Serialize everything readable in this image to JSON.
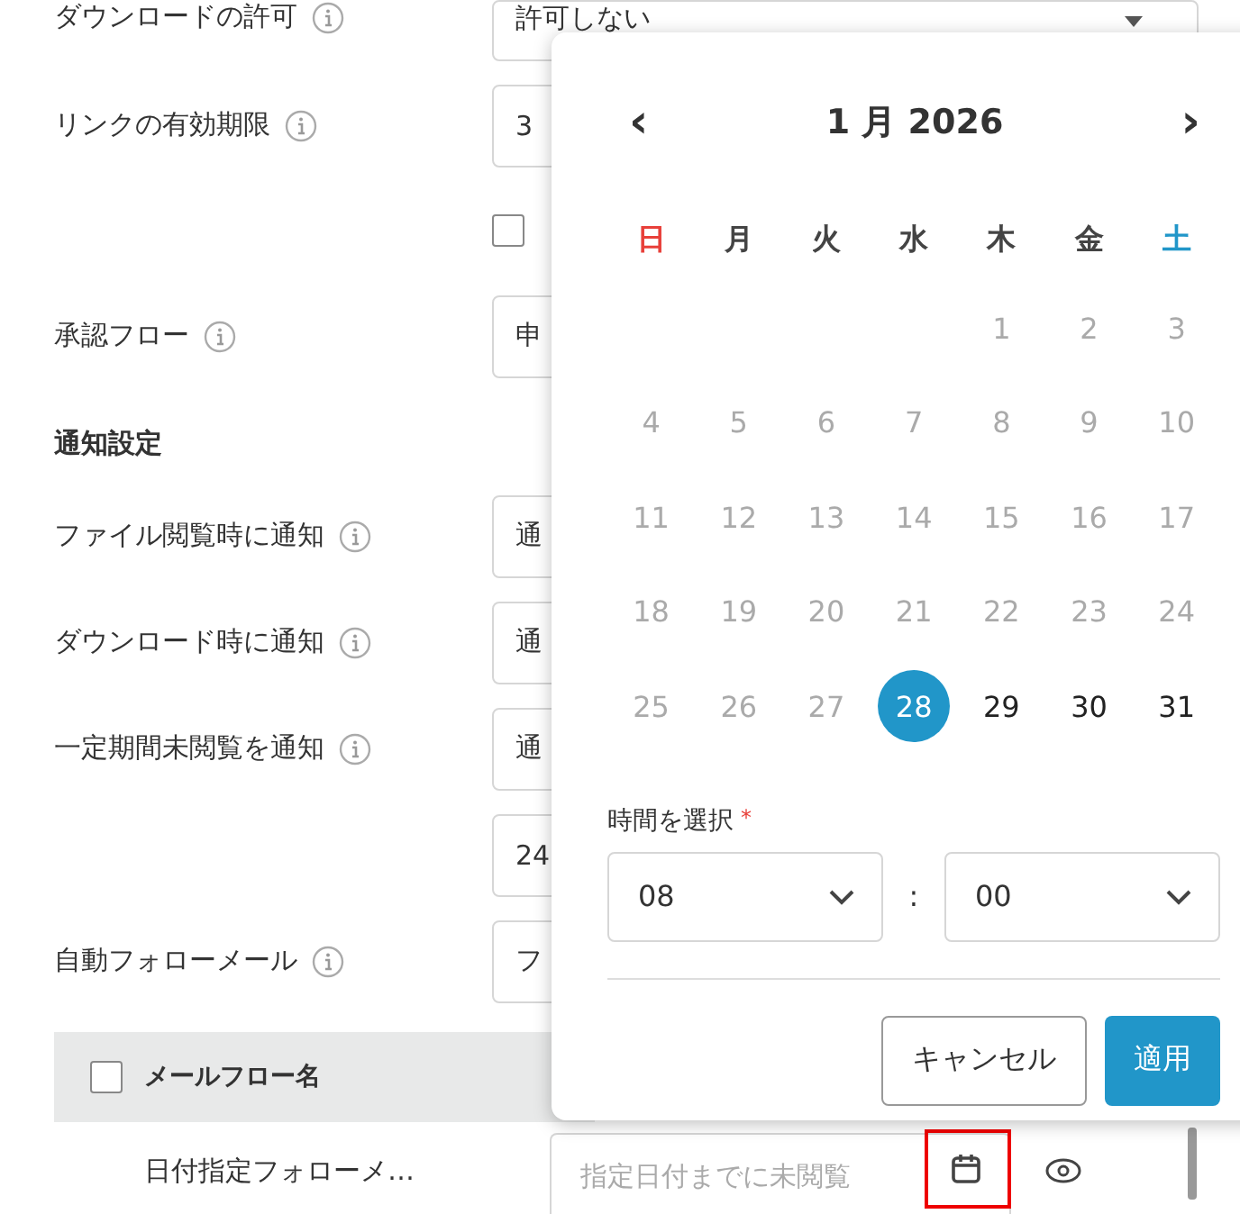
{
  "settings": [
    {
      "kind": "select",
      "label": "ダウンロードの許可",
      "value": "許可しない"
    },
    {
      "kind": "select",
      "label": "リンクの有効期限",
      "value": "3"
    },
    {
      "kind": "checkbox",
      "checked": false
    },
    {
      "kind": "select",
      "label": "承認フロー",
      "value": "申"
    },
    {
      "kind": "section",
      "label": "通知設定"
    },
    {
      "kind": "select",
      "label": "ファイル閲覧時に通知",
      "value": "通"
    },
    {
      "kind": "select",
      "label": "ダウンロード時に通知",
      "value": "通"
    },
    {
      "kind": "select",
      "label": "一定期間未閲覧を通知",
      "value": "通"
    },
    {
      "kind": "select",
      "value": "24"
    },
    {
      "kind": "select",
      "label": "自動フォローメール",
      "value": "フ"
    }
  ],
  "table": {
    "header": {
      "checked": false,
      "label": "メールフロー名"
    },
    "row": {
      "name": "日付指定フォローメ…",
      "placeholder": "指定日付までに未閲覧"
    }
  },
  "calendar": {
    "prev": "‹",
    "title": "1 月 2026",
    "next": "›",
    "weekdays": [
      {
        "label": "日",
        "color": "#e8403a"
      },
      {
        "label": "月",
        "color": "#444444"
      },
      {
        "label": "火",
        "color": "#444444"
      },
      {
        "label": "水",
        "color": "#444444"
      },
      {
        "label": "木",
        "color": "#444444"
      },
      {
        "label": "金",
        "color": "#444444"
      },
      {
        "label": "土",
        "color": "#2196c9"
      }
    ],
    "weeks": [
      [
        {
          "kind": "empty"
        },
        {
          "kind": "empty"
        },
        {
          "kind": "empty"
        },
        {
          "kind": "empty"
        },
        {
          "kind": "day",
          "label": "1",
          "disabled": true,
          "selected": false
        },
        {
          "kind": "day",
          "label": "2",
          "disabled": true,
          "selected": false
        },
        {
          "kind": "day",
          "label": "3",
          "disabled": true,
          "selected": false
        }
      ],
      [
        {
          "kind": "day",
          "label": "4",
          "disabled": true,
          "selected": false
        },
        {
          "kind": "day",
          "label": "5",
          "disabled": true,
          "selected": false
        },
        {
          "kind": "day",
          "label": "6",
          "disabled": true,
          "selected": false
        },
        {
          "kind": "day",
          "label": "7",
          "disabled": true,
          "selected": false
        },
        {
          "kind": "day",
          "label": "8",
          "disabled": true,
          "selected": false
        },
        {
          "kind": "day",
          "label": "9",
          "disabled": true,
          "selected": false
        },
        {
          "kind": "day",
          "label": "10",
          "disabled": true,
          "selected": false
        }
      ],
      [
        {
          "kind": "day",
          "label": "11",
          "disabled": true,
          "selected": false
        },
        {
          "kind": "day",
          "label": "12",
          "disabled": true,
          "selected": false
        },
        {
          "kind": "day",
          "label": "13",
          "disabled": true,
          "selected": false
        },
        {
          "kind": "day",
          "label": "14",
          "disabled": true,
          "selected": false
        },
        {
          "kind": "day",
          "label": "15",
          "disabled": true,
          "selected": false
        },
        {
          "kind": "day",
          "label": "16",
          "disabled": true,
          "selected": false
        },
        {
          "kind": "day",
          "label": "17",
          "disabled": true,
          "selected": false
        }
      ],
      [
        {
          "kind": "day",
          "label": "18",
          "disabled": true,
          "selected": false
        },
        {
          "kind": "day",
          "label": "19",
          "disabled": true,
          "selected": false
        },
        {
          "kind": "day",
          "label": "20",
          "disabled": true,
          "selected": false
        },
        {
          "kind": "day",
          "label": "21",
          "disabled": true,
          "selected": false
        },
        {
          "kind": "day",
          "label": "22",
          "disabled": true,
          "selected": false
        },
        {
          "kind": "day",
          "label": "23",
          "disabled": true,
          "selected": false
        },
        {
          "kind": "day",
          "label": "24",
          "disabled": true,
          "selected": false
        }
      ],
      [
        {
          "kind": "day",
          "label": "25",
          "disabled": true,
          "selected": false
        },
        {
          "kind": "day",
          "label": "26",
          "disabled": true,
          "selected": false
        },
        {
          "kind": "day",
          "label": "27",
          "disabled": true,
          "selected": false
        },
        {
          "kind": "day",
          "label": "28",
          "disabled": false,
          "selected": true
        },
        {
          "kind": "day",
          "label": "29",
          "disabled": false,
          "selected": false
        },
        {
          "kind": "day",
          "label": "30",
          "disabled": false,
          "selected": false
        },
        {
          "kind": "day",
          "label": "31",
          "disabled": false,
          "selected": false
        }
      ]
    ],
    "time_label": "時間を選択",
    "required_mark": "*",
    "hour": "08",
    "separator": ":",
    "minute": "00",
    "buttons": [
      {
        "kind": "secondary",
        "label": "キャンセル"
      },
      {
        "kind": "primary",
        "label": "適用"
      }
    ]
  }
}
